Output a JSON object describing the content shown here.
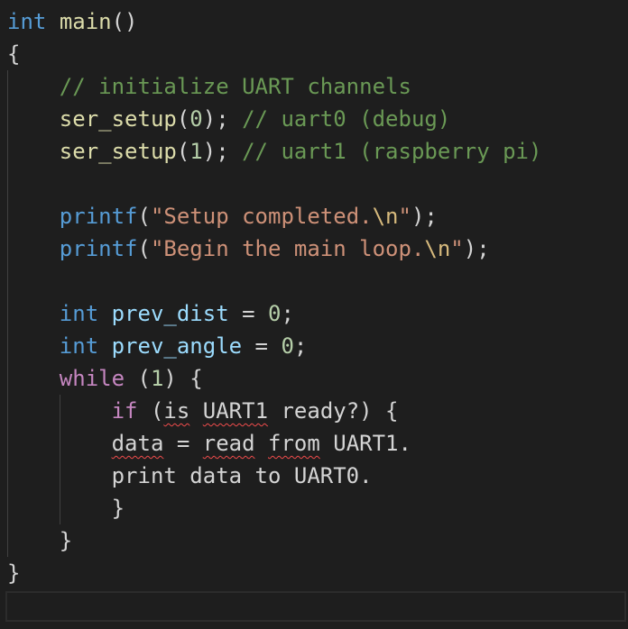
{
  "editor": {
    "lines": [
      [
        {
          "t": "int",
          "c": "k"
        },
        {
          "t": " ",
          "c": "pl"
        },
        {
          "t": "main",
          "c": "fn"
        },
        {
          "t": "()",
          "c": "pl"
        }
      ],
      [
        {
          "t": "{",
          "c": "pl"
        }
      ],
      [
        {
          "t": "    ",
          "c": "pl"
        },
        {
          "t": "// initialize UART channels",
          "c": "com"
        }
      ],
      [
        {
          "t": "    ",
          "c": "pl"
        },
        {
          "t": "ser_setup",
          "c": "fn"
        },
        {
          "t": "(",
          "c": "pl"
        },
        {
          "t": "0",
          "c": "num"
        },
        {
          "t": "); ",
          "c": "pl"
        },
        {
          "t": "// uart0 (debug)",
          "c": "com"
        }
      ],
      [
        {
          "t": "    ",
          "c": "pl"
        },
        {
          "t": "ser_setup",
          "c": "fn"
        },
        {
          "t": "(",
          "c": "pl"
        },
        {
          "t": "1",
          "c": "num"
        },
        {
          "t": "); ",
          "c": "pl"
        },
        {
          "t": "// uart1 (raspberry pi)",
          "c": "com"
        }
      ],
      [],
      [
        {
          "t": "    ",
          "c": "pl"
        },
        {
          "t": "printf",
          "c": "k"
        },
        {
          "t": "(",
          "c": "pl"
        },
        {
          "t": "\"Setup completed.",
          "c": "str"
        },
        {
          "t": "\\n",
          "c": "esc"
        },
        {
          "t": "\"",
          "c": "str"
        },
        {
          "t": ");",
          "c": "pl"
        }
      ],
      [
        {
          "t": "    ",
          "c": "pl"
        },
        {
          "t": "printf",
          "c": "k"
        },
        {
          "t": "(",
          "c": "pl"
        },
        {
          "t": "\"Begin the main loop.",
          "c": "str"
        },
        {
          "t": "\\n",
          "c": "esc"
        },
        {
          "t": "\"",
          "c": "str"
        },
        {
          "t": ");",
          "c": "pl"
        }
      ],
      [],
      [
        {
          "t": "    ",
          "c": "pl"
        },
        {
          "t": "int",
          "c": "k"
        },
        {
          "t": " ",
          "c": "pl"
        },
        {
          "t": "prev_dist",
          "c": "var"
        },
        {
          "t": " = ",
          "c": "pl"
        },
        {
          "t": "0",
          "c": "num"
        },
        {
          "t": ";",
          "c": "pl"
        }
      ],
      [
        {
          "t": "    ",
          "c": "pl"
        },
        {
          "t": "int",
          "c": "k"
        },
        {
          "t": " ",
          "c": "pl"
        },
        {
          "t": "prev_angle",
          "c": "var"
        },
        {
          "t": " = ",
          "c": "pl"
        },
        {
          "t": "0",
          "c": "num"
        },
        {
          "t": ";",
          "c": "pl"
        }
      ],
      [
        {
          "t": "    ",
          "c": "pl"
        },
        {
          "t": "while",
          "c": "ctl"
        },
        {
          "t": " (",
          "c": "pl"
        },
        {
          "t": "1",
          "c": "num"
        },
        {
          "t": ") {",
          "c": "pl"
        }
      ],
      [
        {
          "t": "        ",
          "c": "pl"
        },
        {
          "t": "if",
          "c": "ctl"
        },
        {
          "t": " (",
          "c": "pl"
        },
        {
          "t": "is",
          "c": "pl",
          "err": true
        },
        {
          "t": " ",
          "c": "pl"
        },
        {
          "t": "UART1",
          "c": "pl",
          "err": true
        },
        {
          "t": " ready?) {",
          "c": "pl"
        }
      ],
      [
        {
          "t": "        ",
          "c": "pl"
        },
        {
          "t": "data",
          "c": "pl",
          "err": true
        },
        {
          "t": " = ",
          "c": "pl"
        },
        {
          "t": "read",
          "c": "pl",
          "err": true
        },
        {
          "t": " ",
          "c": "pl"
        },
        {
          "t": "from",
          "c": "pl",
          "err": true
        },
        {
          "t": " UART1.",
          "c": "pl"
        }
      ],
      [
        {
          "t": "        print data to UART0.",
          "c": "pl"
        }
      ],
      [
        {
          "t": "        }",
          "c": "pl"
        }
      ],
      [
        {
          "t": "    }",
          "c": "pl"
        }
      ],
      [
        {
          "t": "}",
          "c": "pl"
        }
      ]
    ]
  }
}
